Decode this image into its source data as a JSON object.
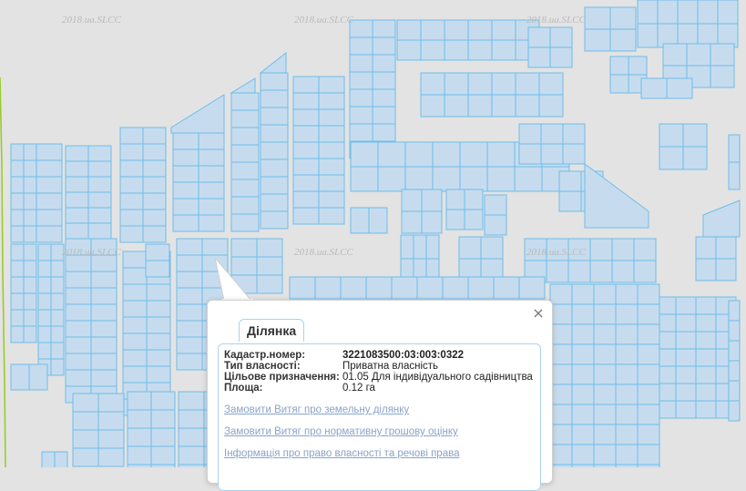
{
  "map": {
    "watermark": "2018.ua.SLCC",
    "plot_fill": "#c6dcee",
    "plot_stroke": "#6fbde8",
    "background": "#e3e3e3"
  },
  "popup": {
    "tab_label": "Ділянка",
    "close_icon": "×",
    "fields": [
      {
        "label": "Кадастр.номер:",
        "value": "3221083500:03:003:0322"
      },
      {
        "label": "Тип власності:",
        "value": "Приватна власність"
      },
      {
        "label": "Цільове призначення:",
        "value": "01.05 Для індивідуального садівництва"
      },
      {
        "label": "Площа:",
        "value": "0.12 га"
      }
    ],
    "links": [
      "Замовити Витяг про земельну ділянку",
      "Замовити Витяг про нормативну грошову оцінку",
      "Інформація про право власності та речові права"
    ],
    "link_color": "#8aa3c9"
  }
}
